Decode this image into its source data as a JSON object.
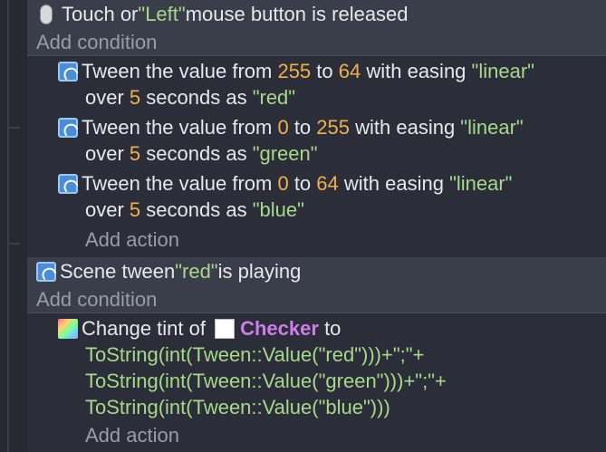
{
  "event1": {
    "condition": {
      "icon": "mouse-icon",
      "prefix": "Touch or ",
      "button": "\"Left\"",
      "suffix": " mouse button is released"
    },
    "add_condition": "Add condition",
    "actions": [
      {
        "icon": "tween-icon",
        "t1": "Tween the value from ",
        "from": "255",
        "t2": " to ",
        "to": "64",
        "t3": " with easing ",
        "easing": "\"linear\"",
        "t4": "over ",
        "duration": "5",
        "t5": " seconds as ",
        "name": "\"red\""
      },
      {
        "icon": "tween-icon",
        "t1": "Tween the value from ",
        "from": "0",
        "t2": " to ",
        "to": "255",
        "t3": " with easing ",
        "easing": "\"linear\"",
        "t4": "over ",
        "duration": "5",
        "t5": " seconds as ",
        "name": "\"green\""
      },
      {
        "icon": "tween-icon",
        "t1": "Tween the value from ",
        "from": "0",
        "t2": " to ",
        "to": "64",
        "t3": " with easing ",
        "easing": "\"linear\"",
        "t4": "over ",
        "duration": "5",
        "t5": " seconds as ",
        "name": "\"blue\""
      }
    ],
    "add_action": "Add action"
  },
  "event2": {
    "condition": {
      "icon": "tween-icon",
      "prefix": "Scene tween ",
      "name": "\"red\"",
      "suffix": " is playing"
    },
    "add_condition": "Add condition",
    "action": {
      "icon": "tint-icon",
      "t1": "Change tint of ",
      "object": "Checker",
      "t2": " to",
      "code_lines": [
        "ToString(int(Tween::Value(\"red\")))+\";\"+",
        "ToString(int(Tween::Value(\"green\")))+\";\"+",
        "ToString(int(Tween::Value(\"blue\")))"
      ]
    },
    "add_action": "Add action"
  },
  "colors": {
    "background": "#2b2d38",
    "condition_background": "#3a3d4a",
    "string": "#a6d98a",
    "number": "#f0b04c",
    "object": "#cc7fea",
    "muted": "#9a9ca8"
  }
}
